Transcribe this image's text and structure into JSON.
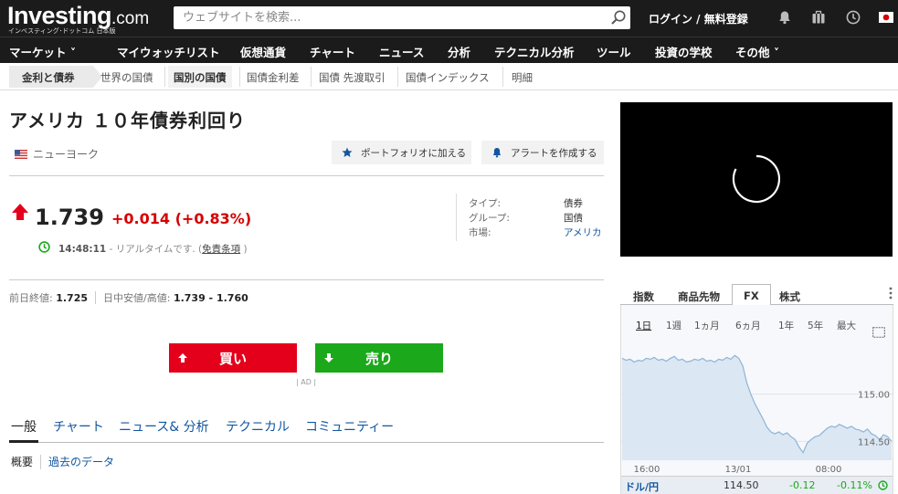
{
  "header": {
    "logo_main": "Investing",
    "logo_dotcom": ".com",
    "logo_sub": "インベスティング･ドットコム 日本版",
    "search_placeholder": "ウェブサイトを検索...",
    "login_label": "ログイン / 無料登録",
    "icons": [
      "bell-icon",
      "briefcase-icon",
      "clock-icon",
      "japan-flag-icon"
    ]
  },
  "main_nav": [
    {
      "label": "マーケット ˅"
    },
    {
      "label": "マイウォッチリスト"
    },
    {
      "label": "仮想通貨"
    },
    {
      "label": "チャート"
    },
    {
      "label": "ニュース"
    },
    {
      "label": "分析"
    },
    {
      "label": "テクニカル分析"
    },
    {
      "label": "ツール"
    },
    {
      "label": "投資の学校"
    },
    {
      "label": "その他 ˅"
    }
  ],
  "sub_nav": {
    "first": "金利と債券",
    "items": [
      "世界の国債",
      "国別の国債",
      "国債金利差",
      "国債 先渡取引",
      "国債インデックス",
      "明細"
    ]
  },
  "instrument": {
    "title": "アメリカ １０年債券利回り",
    "exchange": "ニューヨーク",
    "portfolio_button": "ポートフォリオに加える",
    "alert_button": "アラートを作成する",
    "price": "1.739",
    "change": "+0.014",
    "change_pct": "(+0.83%)",
    "time": "14:48:11",
    "realtime_text": " - リアルタイムです. (",
    "disclaimer": "免責条項",
    "realtime_close": " )",
    "info": {
      "type_label": "タイプ:",
      "type_value": "債券",
      "group_label": "グループ:",
      "group_value": "国債",
      "market_label": "市場:",
      "market_value": "アメリカ"
    },
    "prev_close_label": "前日終値:",
    "prev_close": "1.725",
    "day_range_label": "日中安値/高値:",
    "day_range": "1.739 - 1.760"
  },
  "trade": {
    "buy": "買い",
    "sell": "売り",
    "ad": "| AD |"
  },
  "tabs": [
    "一般",
    "チャート",
    "ニュース& 分析",
    "テクニカル",
    "コミュニティー"
  ],
  "subtabs": [
    "概要",
    "過去のデータ"
  ],
  "widget": {
    "tabs": [
      "指数",
      "商品先物",
      "FX",
      "株式"
    ],
    "active_tab": "FX",
    "ranges": [
      "1日",
      "1週",
      "1ヵ月",
      "6ヵ月",
      "1年",
      "5年",
      "最大"
    ],
    "active_range": "1日",
    "pair_name": "ドル/円",
    "pair_price": "114.50",
    "pair_change": "-0.12",
    "pair_change_pct": "-0.11%"
  },
  "chart_data": {
    "type": "area",
    "title": "",
    "x_tick_labels": [
      "16:00",
      "13/01",
      "08:00"
    ],
    "y_tick_labels": [
      "115.00",
      "114.50"
    ],
    "ylim": [
      114.3,
      115.5
    ],
    "values": [
      115.38,
      115.36,
      115.37,
      115.34,
      115.36,
      115.35,
      115.38,
      115.37,
      115.39,
      115.36,
      115.37,
      115.35,
      115.38,
      115.4,
      115.36,
      115.37,
      115.34,
      115.35,
      115.37,
      115.36,
      115.38,
      115.35,
      115.36,
      115.34,
      115.37,
      115.36,
      115.39,
      115.37,
      115.41,
      115.38,
      115.3,
      115.12,
      115.0,
      114.9,
      114.82,
      114.74,
      114.65,
      114.6,
      114.58,
      114.6,
      114.57,
      114.59,
      114.55,
      114.52,
      114.44,
      114.38,
      114.48,
      114.52,
      114.55,
      114.56,
      114.6,
      114.64,
      114.66,
      114.65,
      114.68,
      114.66,
      114.64,
      114.66,
      114.63,
      114.62,
      114.6,
      114.63,
      114.58,
      114.56,
      114.52,
      114.57,
      114.55,
      114.5
    ]
  }
}
